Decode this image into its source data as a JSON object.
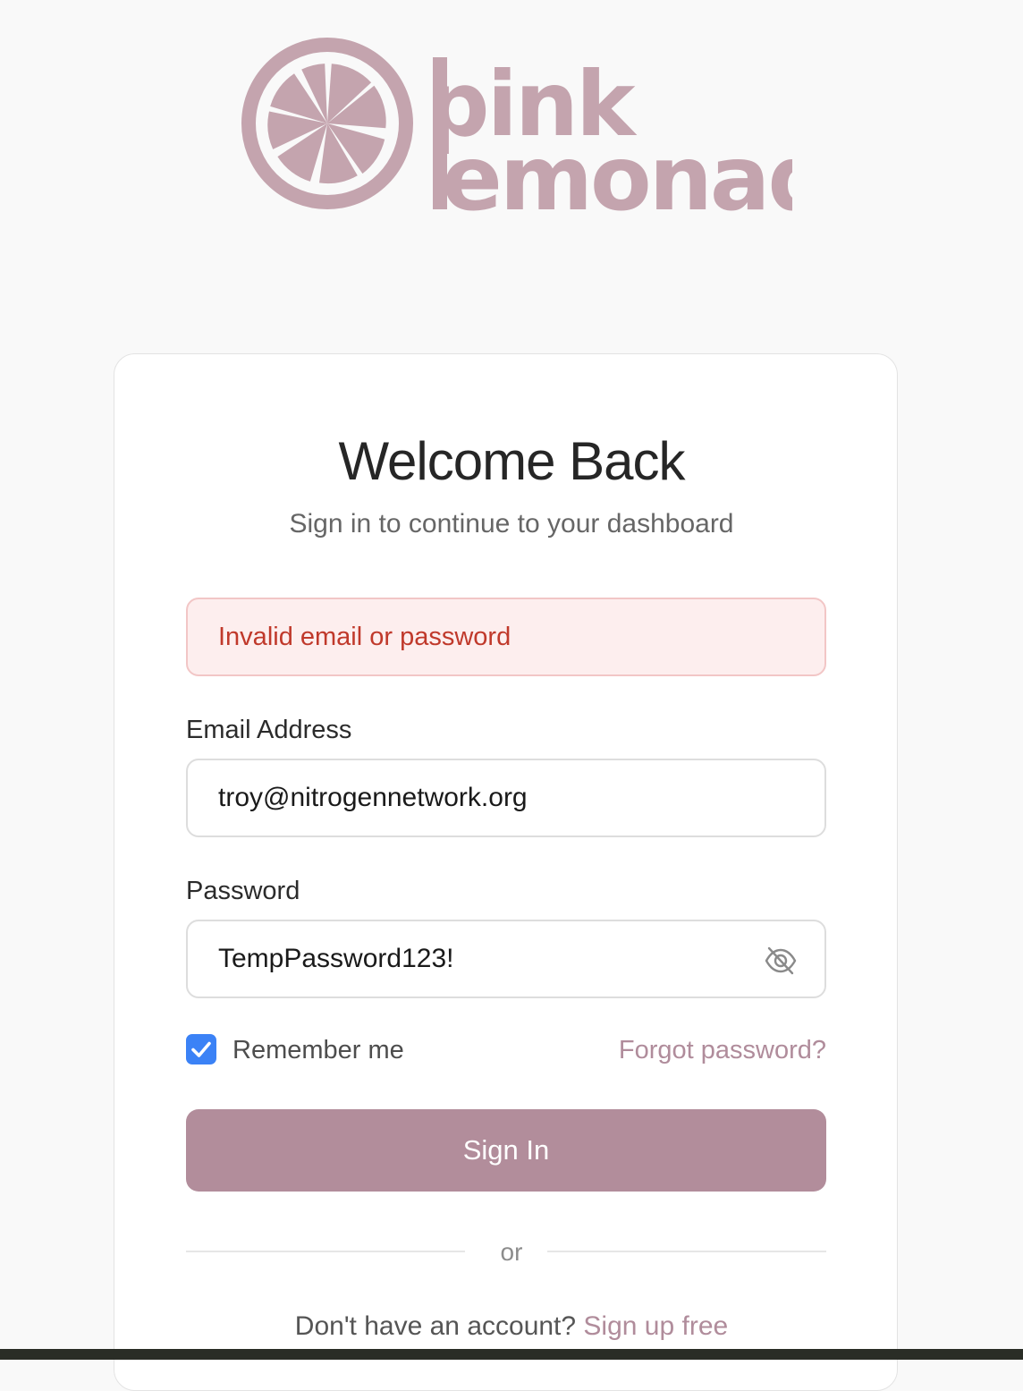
{
  "logo": {
    "line1": "pink",
    "line2": "emonade",
    "icon": "lemon-slice-icon",
    "color": "#c4a4ae"
  },
  "login": {
    "title": "Welcome Back",
    "subtitle": "Sign in to continue to your dashboard",
    "error_message": "Invalid email or password",
    "email_label": "Email Address",
    "email_value": "troy@nitrogennetwork.org",
    "password_label": "Password",
    "password_value": "TempPassword123!",
    "password_toggle_icon": "eye-off-icon",
    "remember_label": "Remember me",
    "remember_checked": true,
    "forgot_link": "Forgot password?",
    "signin_button": "Sign In",
    "divider_text": "or",
    "signup_prompt": "Don't have an account?",
    "signup_link": "Sign up free"
  },
  "colors": {
    "accent": "#b28d9b",
    "link": "#b08c9b",
    "error_text": "#c0392b",
    "error_bg": "#fdeeee",
    "checkbox": "#3b82f6"
  }
}
